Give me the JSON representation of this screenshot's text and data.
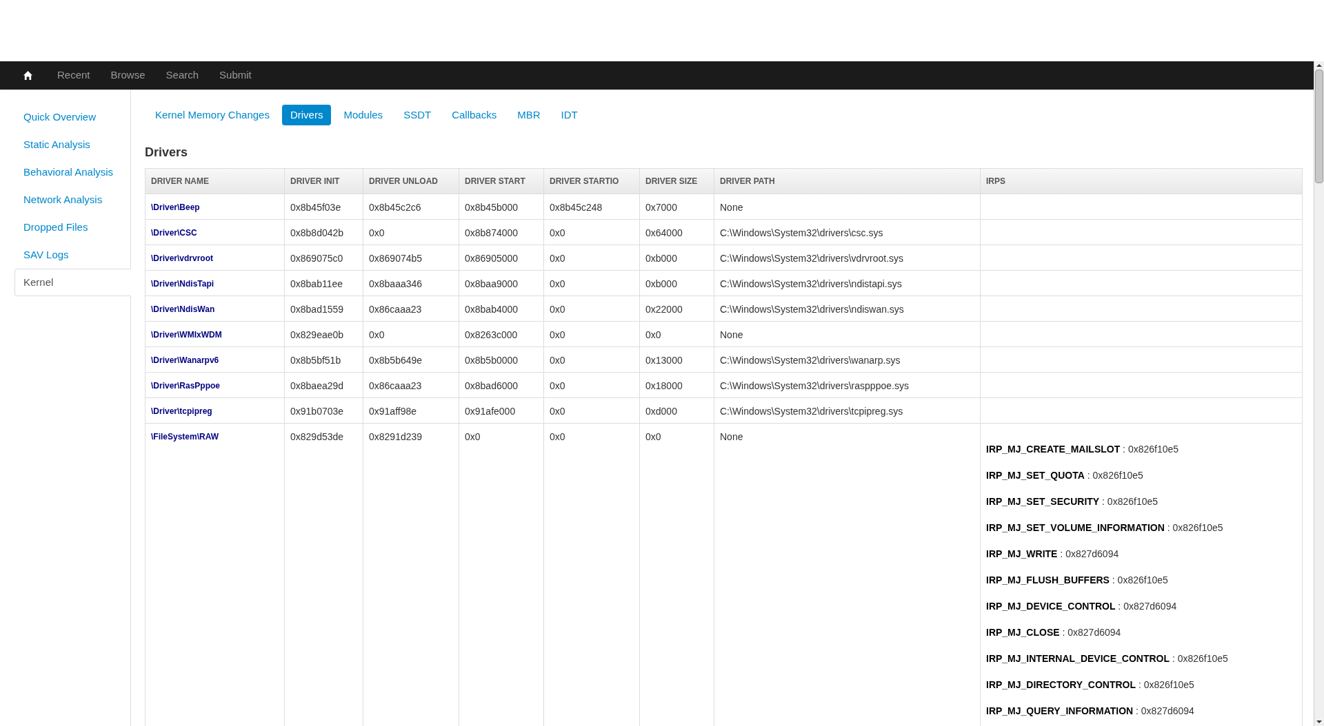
{
  "navbar": {
    "items": [
      "Recent",
      "Browse",
      "Search",
      "Submit"
    ]
  },
  "sidebar": {
    "items": [
      {
        "label": "Quick Overview",
        "selected": false
      },
      {
        "label": "Static Analysis",
        "selected": false
      },
      {
        "label": "Behavioral Analysis",
        "selected": false
      },
      {
        "label": "Network Analysis",
        "selected": false
      },
      {
        "label": "Dropped Files",
        "selected": false
      },
      {
        "label": "SAV Logs",
        "selected": false
      },
      {
        "label": "Kernel",
        "selected": true
      }
    ]
  },
  "tabs": [
    {
      "label": "Kernel Memory Changes",
      "selected": false
    },
    {
      "label": "Drivers",
      "selected": true
    },
    {
      "label": "Modules",
      "selected": false
    },
    {
      "label": "SSDT",
      "selected": false
    },
    {
      "label": "Callbacks",
      "selected": false
    },
    {
      "label": "MBR",
      "selected": false
    },
    {
      "label": "IDT",
      "selected": false
    }
  ],
  "section_title": "Drivers",
  "table": {
    "columns": [
      "DRIVER NAME",
      "DRIVER INIT",
      "DRIVER UNLOAD",
      "DRIVER START",
      "DRIVER STARTIO",
      "DRIVER SIZE",
      "DRIVER PATH",
      "IRPS"
    ],
    "rows": [
      {
        "name": "\\Driver\\Beep",
        "init": "0x8b45f03e",
        "unload": "0x8b45c2c6",
        "start": "0x8b45b000",
        "startio": "0x8b45c248",
        "size": "0x7000",
        "path": "None",
        "irps": []
      },
      {
        "name": "\\Driver\\CSC",
        "init": "0x8b8d042b",
        "unload": "0x0",
        "start": "0x8b874000",
        "startio": "0x0",
        "size": "0x64000",
        "path": "C:\\Windows\\System32\\drivers\\csc.sys",
        "irps": []
      },
      {
        "name": "\\Driver\\vdrvroot",
        "init": "0x869075c0",
        "unload": "0x869074b5",
        "start": "0x86905000",
        "startio": "0x0",
        "size": "0xb000",
        "path": "C:\\Windows\\System32\\drivers\\vdrvroot.sys",
        "irps": []
      },
      {
        "name": "\\Driver\\NdisTapi",
        "init": "0x8bab11ee",
        "unload": "0x8baaa346",
        "start": "0x8baa9000",
        "startio": "0x0",
        "size": "0xb000",
        "path": "C:\\Windows\\System32\\drivers\\ndistapi.sys",
        "irps": []
      },
      {
        "name": "\\Driver\\NdisWan",
        "init": "0x8bad1559",
        "unload": "0x86caaa23",
        "start": "0x8bab4000",
        "startio": "0x0",
        "size": "0x22000",
        "path": "C:\\Windows\\System32\\drivers\\ndiswan.sys",
        "irps": []
      },
      {
        "name": "\\Driver\\WMIxWDM",
        "init": "0x829eae0b",
        "unload": "0x0",
        "start": "0x8263c000",
        "startio": "0x0",
        "size": "0x0",
        "path": "None",
        "irps": []
      },
      {
        "name": "\\Driver\\Wanarpv6",
        "init": "0x8b5bf51b",
        "unload": "0x8b5b649e",
        "start": "0x8b5b0000",
        "startio": "0x0",
        "size": "0x13000",
        "path": "C:\\Windows\\System32\\drivers\\wanarp.sys",
        "irps": []
      },
      {
        "name": "\\Driver\\RasPppoe",
        "init": "0x8baea29d",
        "unload": "0x86caaa23",
        "start": "0x8bad6000",
        "startio": "0x0",
        "size": "0x18000",
        "path": "C:\\Windows\\System32\\drivers\\raspppoe.sys",
        "irps": []
      },
      {
        "name": "\\Driver\\tcpipreg",
        "init": "0x91b0703e",
        "unload": "0x91aff98e",
        "start": "0x91afe000",
        "startio": "0x0",
        "size": "0xd000",
        "path": "C:\\Windows\\System32\\drivers\\tcpipreg.sys",
        "irps": []
      },
      {
        "name": "\\FileSystem\\RAW",
        "init": "0x829d53de",
        "unload": "0x8291d239",
        "start": "0x0",
        "startio": "0x0",
        "size": "0x0",
        "path": "None",
        "irps": [
          "**IRP_MJ_CREATE_MAILSLOT** : 0x826f10e5",
          "**IRP_MJ_SET_QUOTA** : 0x826f10e5",
          "**IRP_MJ_SET_SECURITY** : 0x826f10e5",
          "**IRP_MJ_SET_VOLUME_INFORMATION** : 0x826f10e5",
          "**IRP_MJ_WRITE** : 0x827d6094",
          "**IRP_MJ_FLUSH_BUFFERS** : 0x826f10e5",
          "**IRP_MJ_DEVICE_CONTROL** : 0x827d6094",
          "**IRP_MJ_CLOSE** : 0x827d6094",
          "**IRP_MJ_INTERNAL_DEVICE_CONTROL** : 0x826f10e5",
          "**IRP_MJ_DIRECTORY_CONTROL** : 0x826f10e5",
          "**IRP_MJ_QUERY_INFORMATION** : 0x827d6094"
        ]
      }
    ]
  }
}
